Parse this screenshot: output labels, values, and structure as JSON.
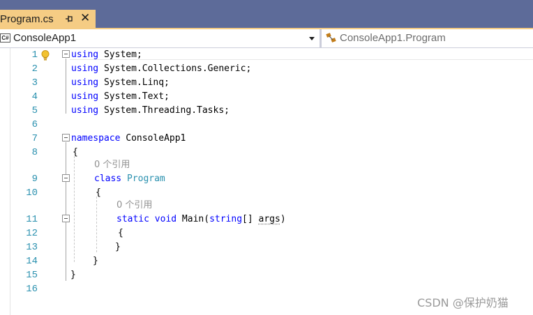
{
  "tab": {
    "title": "Program.cs",
    "pin_icon": "pin-icon",
    "close_glyph": "✕"
  },
  "navbar": {
    "project_badge": "C#",
    "project": "ConsoleApp1",
    "member": "ConsoleApp1.Program"
  },
  "colors": {
    "tab_active": "#f5cc84",
    "tabstrip": "#5d6b99",
    "keyword": "#0000ff",
    "type": "#2b91af",
    "line_number": "#2b91af",
    "codelens": "#8f8f8f"
  },
  "editor": {
    "line_numbers": [
      "1",
      "2",
      "3",
      "4",
      "5",
      "6",
      "7",
      "8",
      "9",
      "10",
      "11",
      "12",
      "13",
      "14",
      "15",
      "16"
    ],
    "code": {
      "l1_kw": "using",
      "l1_rest": " System;",
      "l2_kw": "using",
      "l2_rest": " System.Collections.Generic;",
      "l3_kw": "using",
      "l3_rest": " System.Linq;",
      "l4_kw": "using",
      "l4_rest": " System.Text;",
      "l5_kw": "using",
      "l5_rest": " System.Threading.Tasks;",
      "l7_kw": "namespace",
      "l7_rest": " ConsoleApp1",
      "l8": "{",
      "lens_class": "0 个引用",
      "l9_kw": "class",
      "l9_type": " Program",
      "l10": "{",
      "lens_method": "0 个引用",
      "l11_kw1": "static",
      "l11_kw2": " void",
      "l11_name": " Main(",
      "l11_kw3": "string",
      "l11_brackets": "[] ",
      "l11_arg": "args",
      "l11_close": ")",
      "l12": "{",
      "l13": "}",
      "l14": "}",
      "l15": "}"
    }
  },
  "watermark": "CSDN @保护奶猫"
}
